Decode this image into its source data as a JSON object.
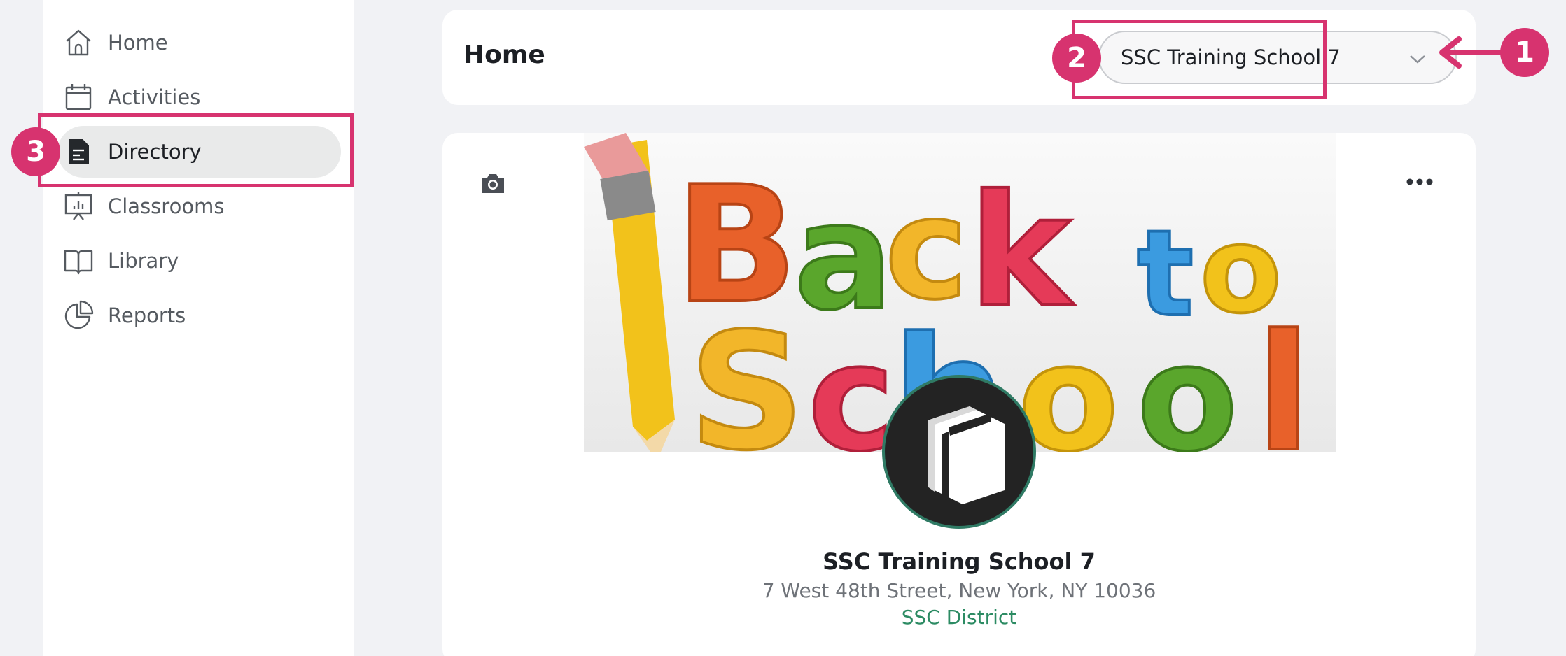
{
  "sidebar": {
    "items": [
      {
        "label": "Home",
        "icon": "home-icon"
      },
      {
        "label": "Activities",
        "icon": "calendar-icon"
      },
      {
        "label": "Directory",
        "icon": "document-icon",
        "active": true
      },
      {
        "label": "Classrooms",
        "icon": "presentation-board-icon"
      },
      {
        "label": "Library",
        "icon": "book-icon"
      },
      {
        "label": "Reports",
        "icon": "pie-chart-icon"
      }
    ]
  },
  "header": {
    "title": "Home",
    "school_selector": {
      "value": "SSC Training School 7",
      "icon": "chevron-down-icon"
    }
  },
  "profile": {
    "banner_text": "Back to School",
    "name": "SSC Training School 7",
    "address": "7 West 48th Street, New York, NY 10036",
    "district": "SSC District",
    "camera_icon": "camera-icon",
    "more_icon": "more-horizontal-icon"
  },
  "annotations": {
    "badge_1": "1",
    "badge_2": "2",
    "badge_3": "3",
    "color": "#d7336f"
  },
  "colors": {
    "accent_green": "#2c8b63",
    "annotation_pink": "#d7336f",
    "background": "#f1f2f5"
  }
}
